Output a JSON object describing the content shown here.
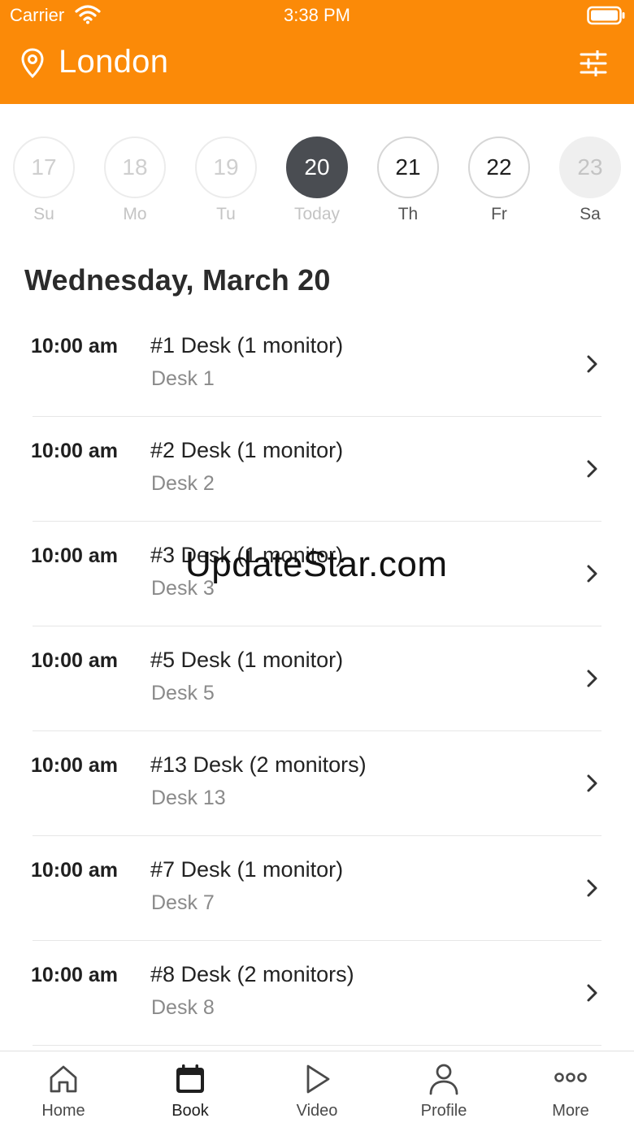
{
  "status_bar": {
    "carrier": "Carrier",
    "time": "3:38 PM"
  },
  "header": {
    "location": "London"
  },
  "days": [
    {
      "number": "17",
      "label": "Su",
      "state": "past"
    },
    {
      "number": "18",
      "label": "Mo",
      "state": "past"
    },
    {
      "number": "19",
      "label": "Tu",
      "state": "past"
    },
    {
      "number": "20",
      "label": "Today",
      "state": "active"
    },
    {
      "number": "21",
      "label": "Th",
      "state": "future"
    },
    {
      "number": "22",
      "label": "Fr",
      "state": "future"
    },
    {
      "number": "23",
      "label": "Sa",
      "state": "muted"
    }
  ],
  "date_heading": "Wednesday, March 20",
  "bookings": [
    {
      "time": "10:00 am",
      "title": "#1 Desk (1 monitor)",
      "subtitle": "Desk 1"
    },
    {
      "time": "10:00 am",
      "title": "#2 Desk (1 monitor)",
      "subtitle": "Desk 2"
    },
    {
      "time": "10:00 am",
      "title": "#3 Desk (1 monitor)",
      "subtitle": "Desk 3"
    },
    {
      "time": "10:00 am",
      "title": "#5 Desk (1 monitor)",
      "subtitle": "Desk 5"
    },
    {
      "time": "10:00 am",
      "title": "#13 Desk (2 monitors)",
      "subtitle": "Desk 13"
    },
    {
      "time": "10:00 am",
      "title": "#7 Desk (1 monitor)",
      "subtitle": "Desk 7"
    },
    {
      "time": "10:00 am",
      "title": "#8 Desk (2 monitors)",
      "subtitle": "Desk 8"
    }
  ],
  "watermark": "UpdateStar.com",
  "tabs": [
    {
      "label": "Home",
      "icon": "home-icon"
    },
    {
      "label": "Book",
      "icon": "calendar-icon",
      "active": true
    },
    {
      "label": "Video",
      "icon": "play-icon"
    },
    {
      "label": "Profile",
      "icon": "profile-icon"
    },
    {
      "label": "More",
      "icon": "more-icon"
    }
  ],
  "colors": {
    "accent": "#fb8a08",
    "active_day": "#4a4d52"
  }
}
